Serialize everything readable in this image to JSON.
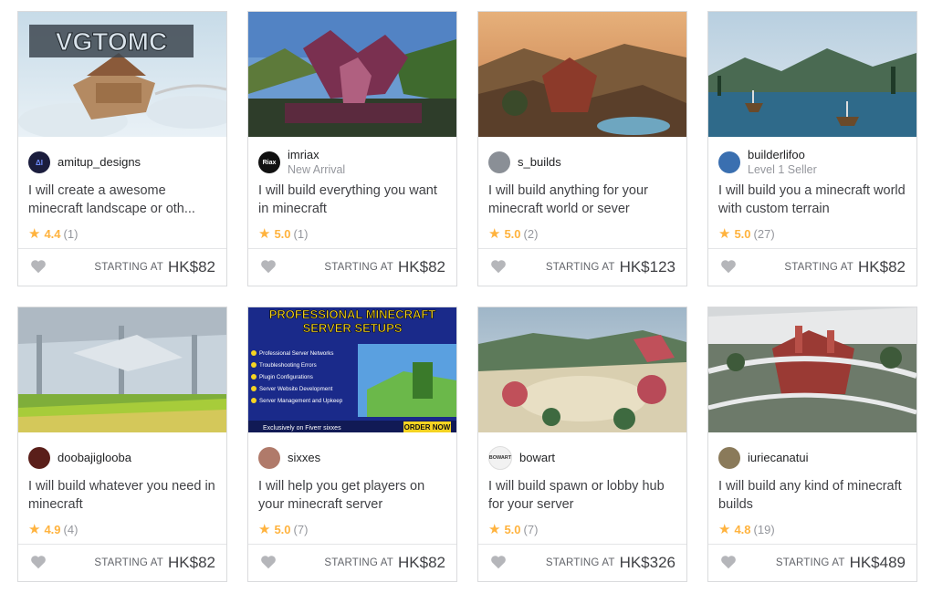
{
  "price_label": "STARTING AT",
  "gigs": [
    {
      "seller": "amitup_designs",
      "seller_level": "",
      "avatar_text": "ΔI",
      "title": "I will create a awesome minecraft landscape or oth...",
      "rating": "4.4",
      "reviews": "(1)",
      "price": "HK$82",
      "thumb_text": "VGTOMC"
    },
    {
      "seller": "imriax",
      "seller_level": "New Arrival",
      "avatar_text": "Riax",
      "title": "I will build everything you want in minecraft",
      "rating": "5.0",
      "reviews": "(1)",
      "price": "HK$82",
      "thumb_text": ""
    },
    {
      "seller": "s_builds",
      "seller_level": "",
      "avatar_text": "",
      "title": "I will build anything for your minecraft world or sever",
      "rating": "5.0",
      "reviews": "(2)",
      "price": "HK$123",
      "thumb_text": ""
    },
    {
      "seller": "builderlifoo",
      "seller_level": "Level 1 Seller",
      "avatar_text": "",
      "title": "I will build you a minecraft world with custom terrain",
      "rating": "5.0",
      "reviews": "(27)",
      "price": "HK$82",
      "thumb_text": ""
    },
    {
      "seller": "doobajiglooba",
      "seller_level": "",
      "avatar_text": "",
      "title": "I will build whatever you need in minecraft",
      "rating": "4.9",
      "reviews": "(4)",
      "price": "HK$82",
      "thumb_text": ""
    },
    {
      "seller": "sixxes",
      "seller_level": "",
      "avatar_text": "",
      "title": "I will help you get players on your minecraft server",
      "rating": "5.0",
      "reviews": "(7)",
      "price": "HK$82",
      "thumb_text": "PROFESSIONAL MINECRAFT",
      "thumb_sub": "SERVER SETUPS",
      "thumb_items": [
        "Professional Server Networks",
        "Troubleshooting Errors",
        "Plugin Configurations",
        "Server Website Development",
        "Server Management and Upkeep"
      ],
      "thumb_footer": "Exclusively on Fiverr sixxes",
      "thumb_cta": "ORDER NOW"
    },
    {
      "seller": "bowart",
      "seller_level": "",
      "avatar_text": "BOWART",
      "title": "I will build spawn or lobby hub for your server",
      "rating": "5.0",
      "reviews": "(7)",
      "price": "HK$326",
      "thumb_text": ""
    },
    {
      "seller": "iuriecanatui",
      "seller_level": "",
      "avatar_text": "",
      "title": "I will build any kind of minecraft builds",
      "rating": "4.8",
      "reviews": "(19)",
      "price": "HK$489",
      "thumb_text": ""
    }
  ],
  "colors": {
    "star": "#ffb33e",
    "border": "#dadbdd",
    "text": "#404145",
    "muted": "#95979d"
  }
}
